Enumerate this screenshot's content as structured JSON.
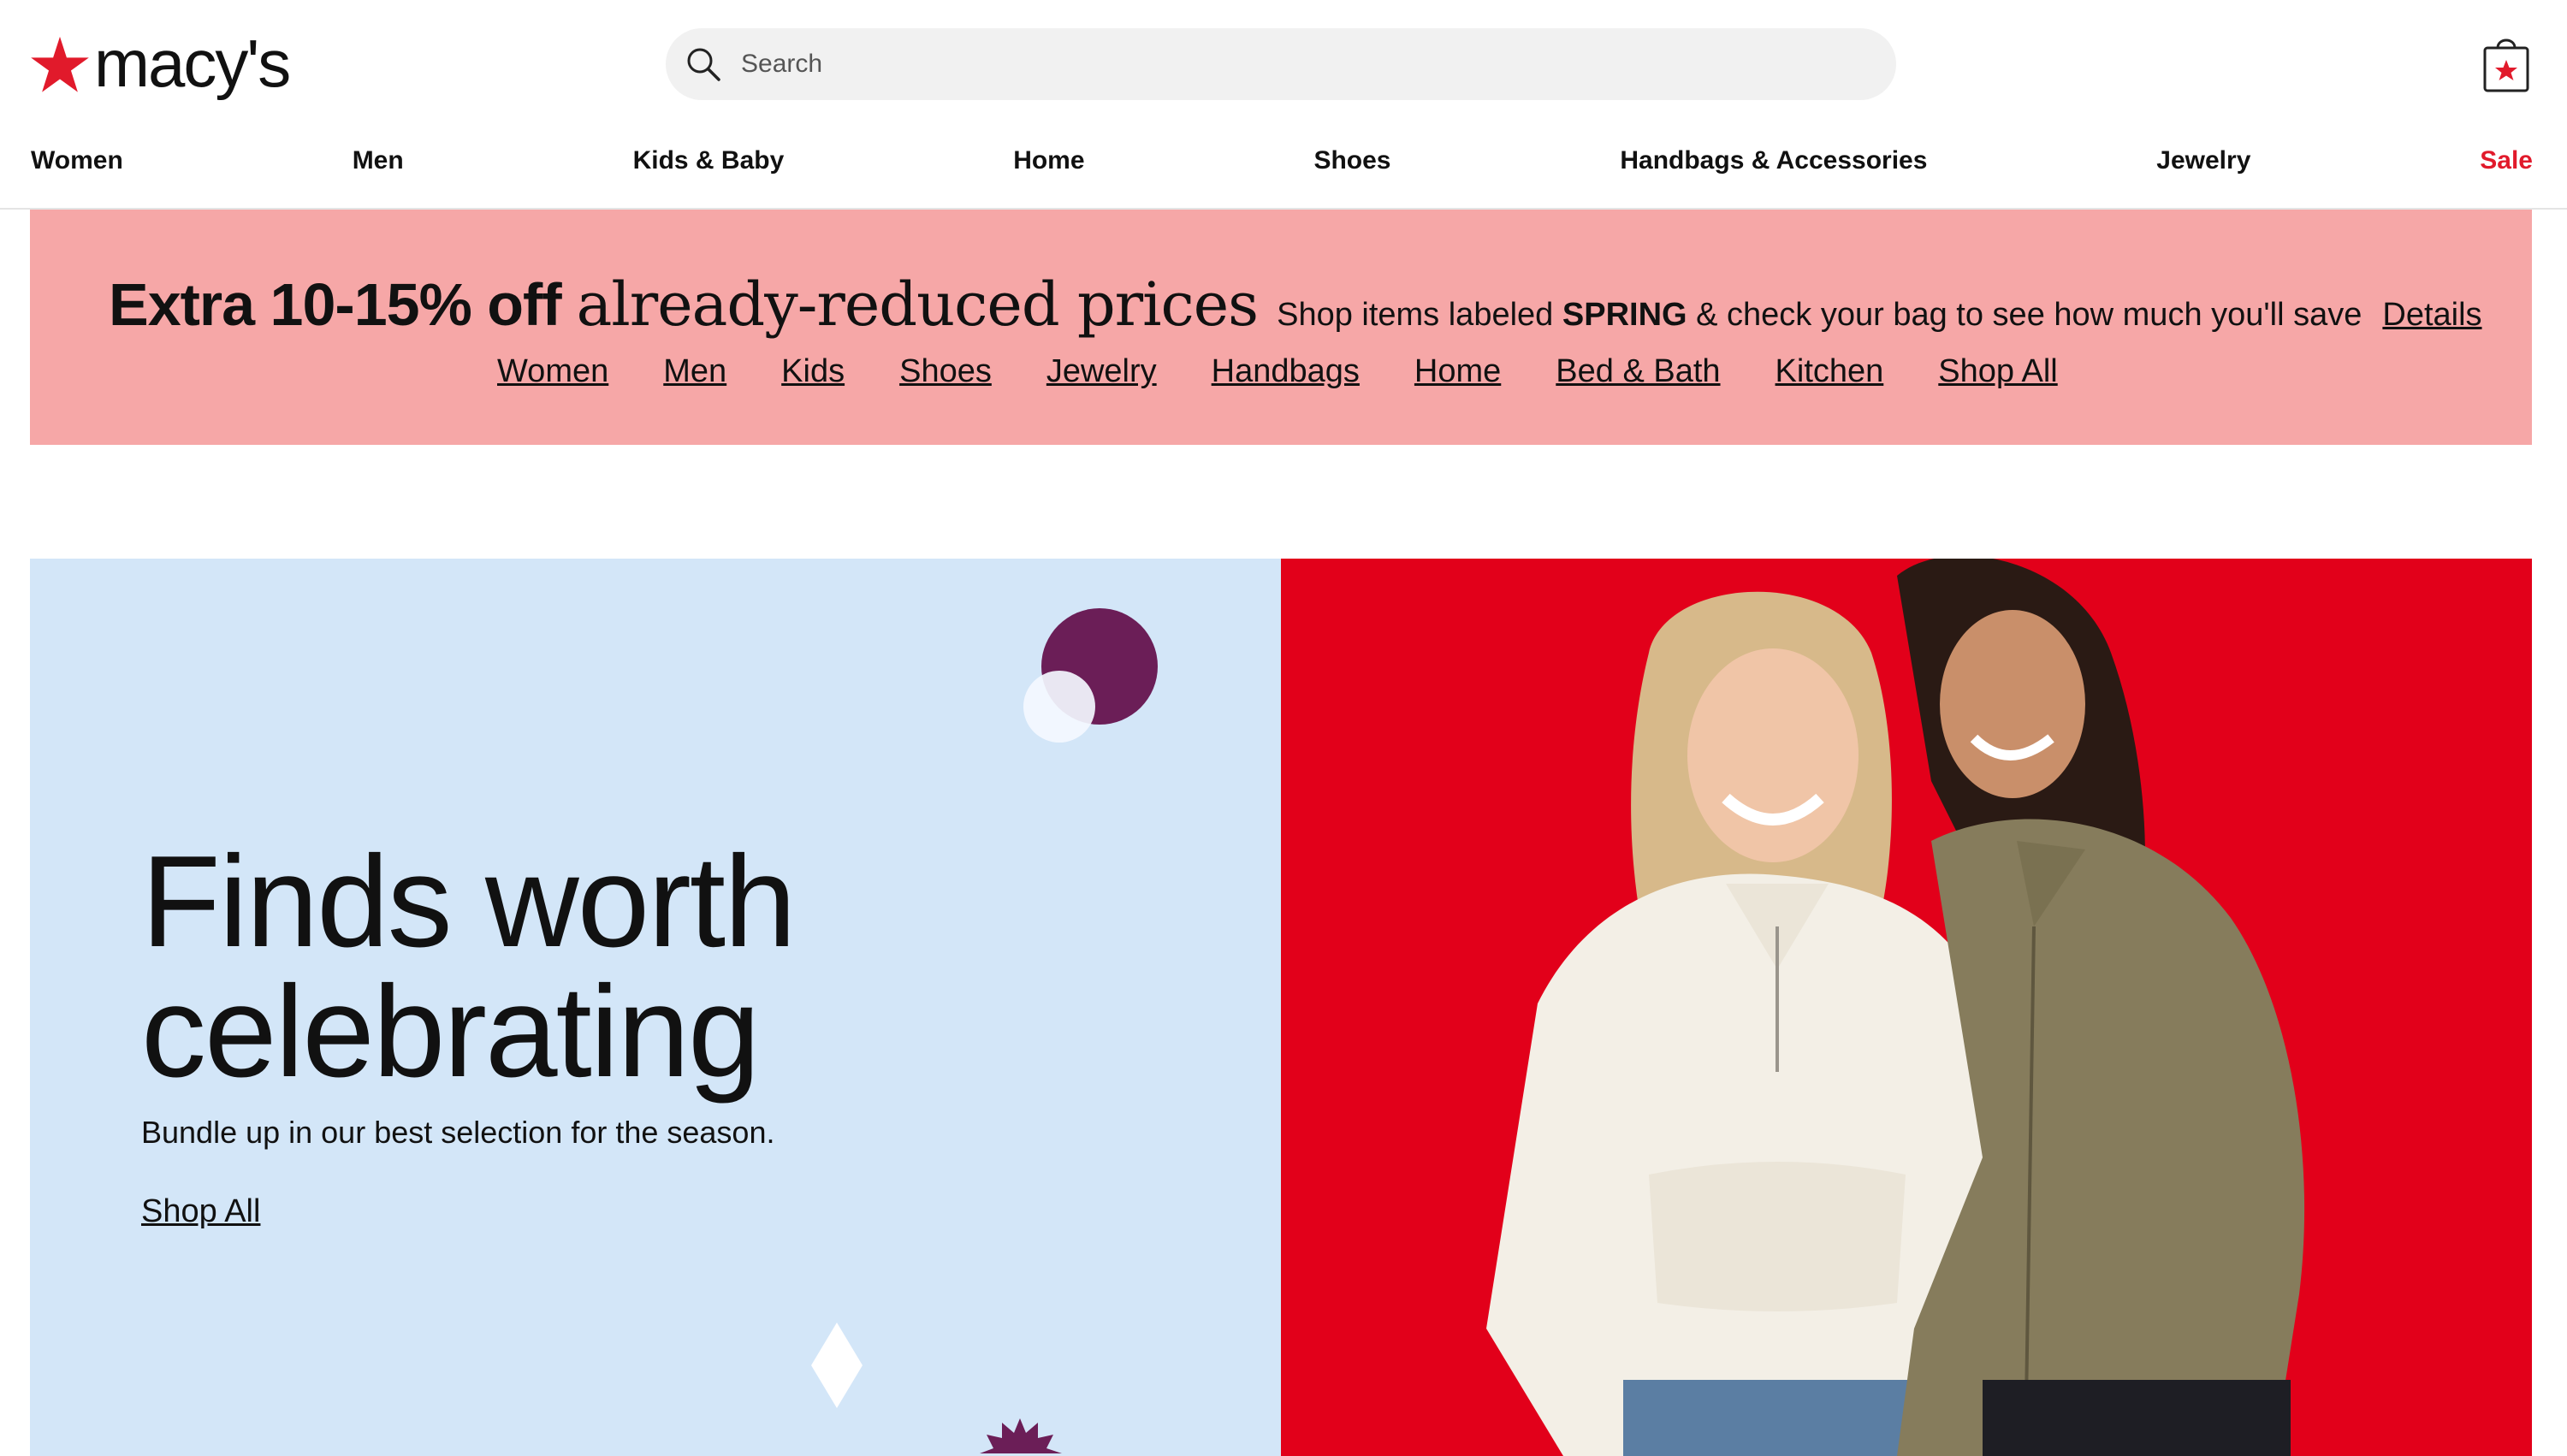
{
  "brand": {
    "name": "macy's",
    "accent_color": "#e11a2b"
  },
  "search": {
    "placeholder": "Search",
    "icon": "search-icon"
  },
  "cart": {
    "icon": "shopping-bag-icon"
  },
  "nav": {
    "items": [
      "Women",
      "Men",
      "Kids & Baby",
      "Home",
      "Shoes",
      "Handbags & Accessories",
      "Jewelry",
      "Sale"
    ],
    "sale_color": "#e11a2b"
  },
  "promo": {
    "headline_bold": "Extra 10-15% off",
    "headline_serif": "already-reduced prices",
    "sub_before": "Shop items labeled",
    "sub_strong": "SPRING",
    "sub_after": "& check your bag to see how much you'll save",
    "details_label": "Details",
    "links": [
      "Women",
      "Men",
      "Kids",
      "Shoes",
      "Jewelry",
      "Handbags",
      "Home",
      "Bed & Bath",
      "Kitchen",
      "Shop All"
    ],
    "background": "#f6a7a7"
  },
  "hero": {
    "title_line1": "Finds worth",
    "title_line2": "celebrating",
    "subtitle": "Bundle up in our best selection for the season.",
    "cta_label": "Shop All",
    "left_background": "#d3e6f8",
    "right_background": "#e2001a"
  }
}
